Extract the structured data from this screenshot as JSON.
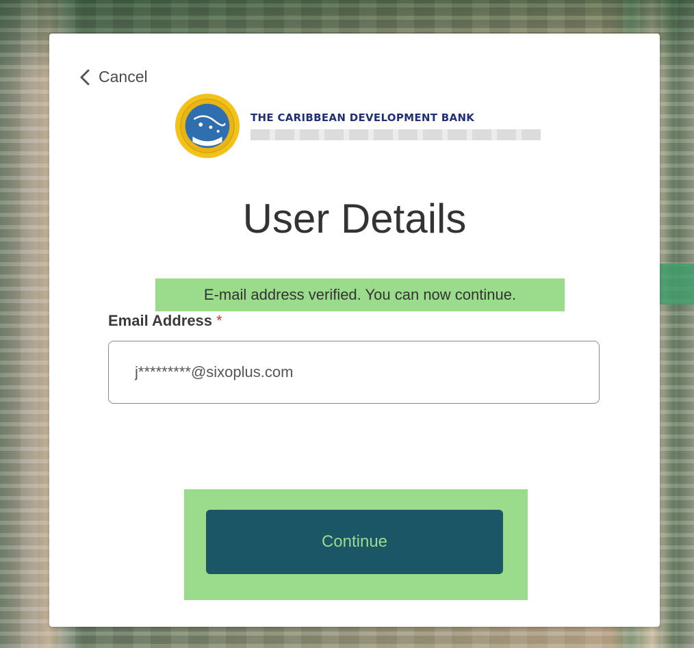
{
  "header": {
    "cancel_label": "Cancel"
  },
  "logo": {
    "name": "THE CARIBBEAN DEVELOPMENT BANK"
  },
  "page": {
    "title": "User Details"
  },
  "status": {
    "message": "E-mail address verified. You can now continue.",
    "color": "#9adb8c"
  },
  "form": {
    "email_label": "Email Address",
    "email_required_mark": "*",
    "email_value": "j*********@sixoplus.com"
  },
  "actions": {
    "continue_label": "Continue",
    "button_color": "#1b5666"
  }
}
